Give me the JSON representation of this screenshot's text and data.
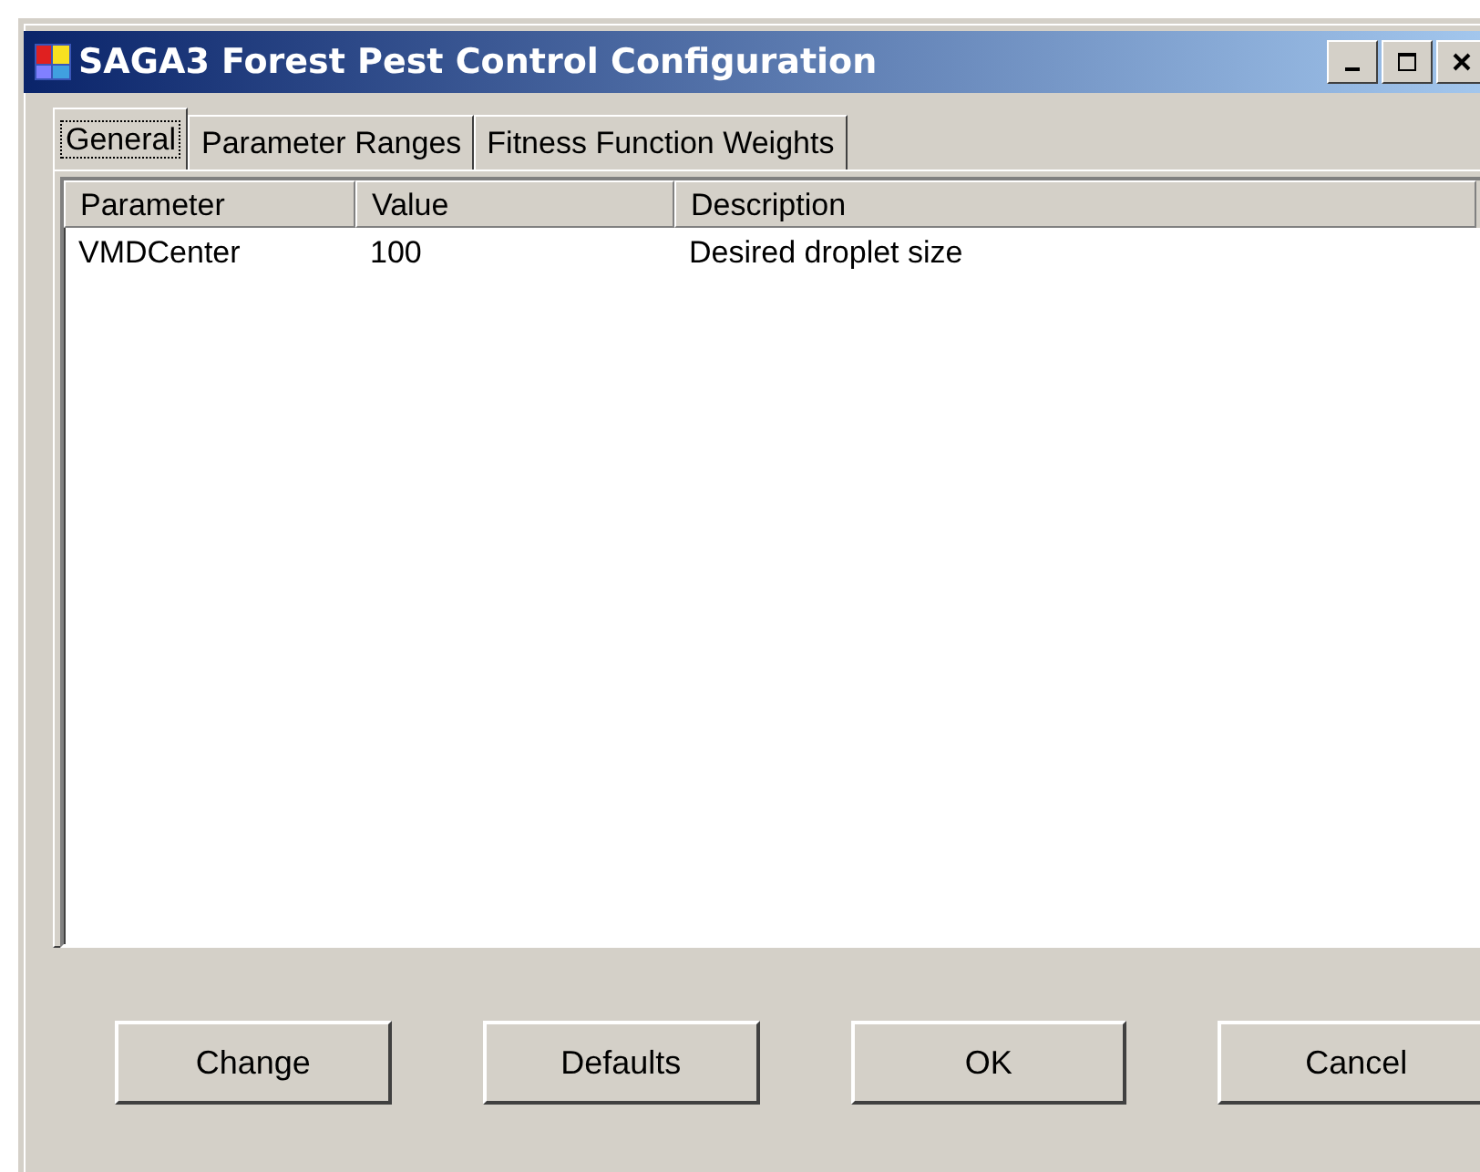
{
  "window": {
    "title": "SAGA3 Forest Pest Control Configuration"
  },
  "tabs": [
    {
      "label": "General",
      "selected": true
    },
    {
      "label": "Parameter Ranges",
      "selected": false
    },
    {
      "label": "Fitness Function Weights",
      "selected": false
    }
  ],
  "table": {
    "columns": [
      "Parameter",
      "Value",
      "Description"
    ],
    "rows": [
      [
        "VMDCenter",
        "100",
        "Desired droplet size"
      ]
    ]
  },
  "buttons": [
    "Change",
    "Defaults",
    "OK",
    "Cancel"
  ]
}
